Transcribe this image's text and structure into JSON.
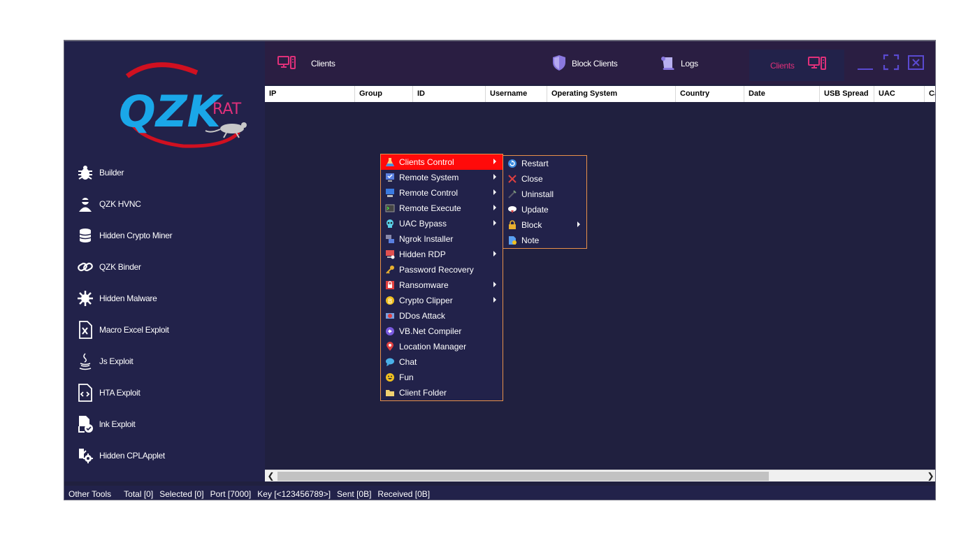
{
  "logo": {
    "text_main": "QZK",
    "text_sub": "RAT"
  },
  "sidebar": {
    "items": [
      {
        "label": "Builder",
        "icon": "bug-icon"
      },
      {
        "label": "QZK HVNC",
        "icon": "hacker-icon"
      },
      {
        "label": "Hidden Crypto Miner",
        "icon": "coins-icon"
      },
      {
        "label": "QZK Binder",
        "icon": "link-icon"
      },
      {
        "label": "Hidden Malware",
        "icon": "virus-icon"
      },
      {
        "label": "Macro Excel Exploit",
        "icon": "excel-file-icon"
      },
      {
        "label": "Js Exploit",
        "icon": "java-icon"
      },
      {
        "label": "HTA Exploit",
        "icon": "code-file-icon"
      },
      {
        "label": "lnk Exploit",
        "icon": "shortcut-file-icon"
      },
      {
        "label": "Hidden CPLApplet",
        "icon": "applet-icon"
      }
    ]
  },
  "topbar": {
    "clients_label": "Clients",
    "block_clients_label": "Block Clients",
    "logs_label": "Logs",
    "active_tab_label": "Clients"
  },
  "grid": {
    "columns": [
      "IP",
      "Group",
      "ID",
      "Username",
      "Operating System",
      "Country",
      "Date",
      "USB Spread",
      "UAC",
      "Ca"
    ],
    "rows": []
  },
  "status": {
    "other_tools": "Other Tools",
    "total": "Total [0]",
    "selected": "Selected [0]",
    "port": "Port [7000]",
    "key": "Key [<123456789>]",
    "sent": "Sent [0B]",
    "received": "Received [0B]"
  },
  "context_menu": {
    "items": [
      {
        "label": "Clients Control",
        "icon": "flask-icon",
        "submenu": true,
        "highlighted": true
      },
      {
        "label": "Remote System",
        "icon": "monitor-check-icon",
        "submenu": true
      },
      {
        "label": "Remote Control",
        "icon": "desktop-icon",
        "submenu": true
      },
      {
        "label": "Remote Execute",
        "icon": "terminal-icon",
        "submenu": true
      },
      {
        "label": "UAC Bypass",
        "icon": "skull-icon",
        "submenu": true
      },
      {
        "label": "Ngrok Installer",
        "icon": "network-icon",
        "submenu": false
      },
      {
        "label": "Hidden RDP",
        "icon": "rdp-icon",
        "submenu": true
      },
      {
        "label": "Password Recovery",
        "icon": "key-icon",
        "submenu": false
      },
      {
        "label": "Ransomware",
        "icon": "lock-file-icon",
        "submenu": true
      },
      {
        "label": "Crypto Clipper",
        "icon": "coin-icon",
        "submenu": true
      },
      {
        "label": "DDos Attack",
        "icon": "ddos-icon",
        "submenu": false
      },
      {
        "label": "VB.Net Compiler",
        "icon": "visual-studio-icon",
        "submenu": false
      },
      {
        "label": "Location Manager",
        "icon": "map-pin-icon",
        "submenu": false
      },
      {
        "label": "Chat",
        "icon": "chat-icon",
        "submenu": false
      },
      {
        "label": "Fun",
        "icon": "smile-icon",
        "submenu": false
      },
      {
        "label": "Client Folder",
        "icon": "folder-icon",
        "submenu": false
      }
    ]
  },
  "submenu": {
    "items": [
      {
        "label": "Restart",
        "icon": "restart-icon",
        "submenu": false
      },
      {
        "label": "Close",
        "icon": "close-icon",
        "submenu": false
      },
      {
        "label": "Uninstall",
        "icon": "uninstall-icon",
        "submenu": false
      },
      {
        "label": "Update",
        "icon": "cloud-download-icon",
        "submenu": false
      },
      {
        "label": "Block",
        "icon": "lock-icon",
        "submenu": true
      },
      {
        "label": "Note",
        "icon": "note-icon",
        "submenu": false
      }
    ]
  },
  "colors": {
    "background": "#20203f",
    "sidebar": "#22224a",
    "topbar": "#2a1e42",
    "accent": "#e0307a",
    "highlight": "#ff0a0a",
    "menu_border": "#e8904a"
  }
}
